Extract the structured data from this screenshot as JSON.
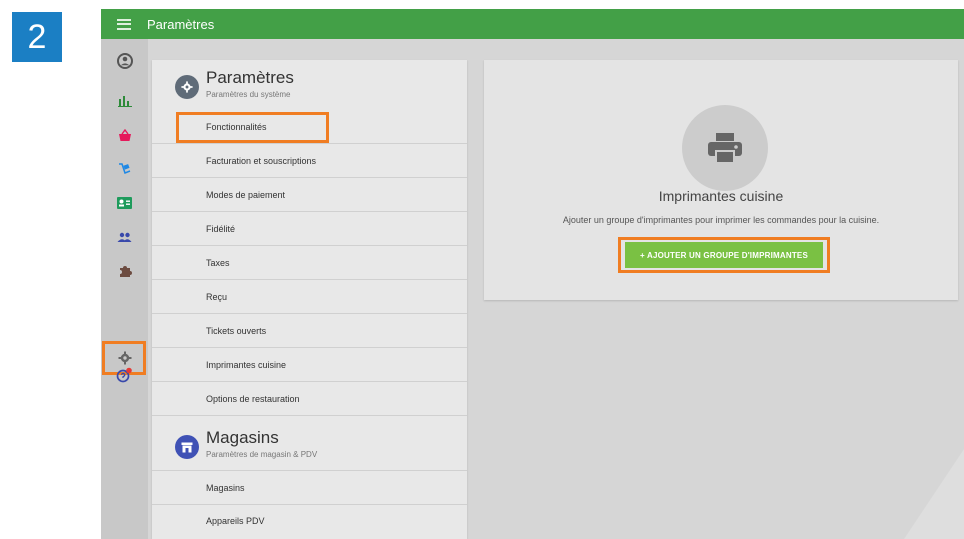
{
  "step_number": "2",
  "header": {
    "title": "Paramètres"
  },
  "sidebar": {
    "icons": [
      "account-icon",
      "bar-chart-icon",
      "basket-icon",
      "cart-icon",
      "contact-card-icon",
      "people-icon",
      "puzzle-icon",
      "gear-icon",
      "help-icon"
    ],
    "active": "gear-icon",
    "notification_color": "#e53935"
  },
  "settings_section": {
    "title": "Paramètres",
    "subtitle": "Paramètres du système",
    "items": [
      {
        "label": "Fonctionnalités"
      },
      {
        "label": "Facturation et souscriptions"
      },
      {
        "label": "Modes de paiement"
      },
      {
        "label": "Fidélité"
      },
      {
        "label": "Taxes"
      },
      {
        "label": "Reçu"
      },
      {
        "label": "Tickets ouverts"
      },
      {
        "label": "Imprimantes cuisine"
      },
      {
        "label": "Options de restauration"
      }
    ]
  },
  "stores_section": {
    "title": "Magasins",
    "subtitle": "Paramètres de magasin & PDV",
    "items": [
      {
        "label": "Magasins"
      },
      {
        "label": "Appareils PDV"
      }
    ]
  },
  "printer_card": {
    "title": "Imprimantes cuisine",
    "description": "Ajouter un groupe d'imprimantes pour imprimer les commandes pour la cuisine.",
    "button_label": "+ AJOUTER UN GROUPE D'IMPRIMANTES"
  },
  "colors": {
    "topbar": "#43a047",
    "highlight": "#f07d22",
    "button": "#7ac143",
    "step_badge": "#1b7fc4"
  }
}
